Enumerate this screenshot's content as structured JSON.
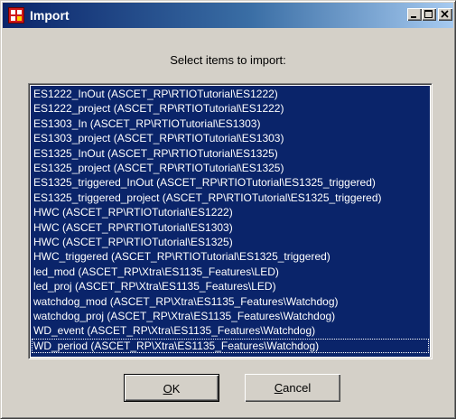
{
  "window": {
    "title": "Import",
    "title_icon": "import-app-icon",
    "controls": [
      "minimize-icon",
      "maximize-icon",
      "close-icon"
    ]
  },
  "prompt": "Select items to import:",
  "items": [
    "ES1222_InOut (ASCET_RP\\RTIOTutorial\\ES1222)",
    "ES1222_project (ASCET_RP\\RTIOTutorial\\ES1222)",
    "ES1303_In (ASCET_RP\\RTIOTutorial\\ES1303)",
    "ES1303_project (ASCET_RP\\RTIOTutorial\\ES1303)",
    "ES1325_InOut (ASCET_RP\\RTIOTutorial\\ES1325)",
    "ES1325_project (ASCET_RP\\RTIOTutorial\\ES1325)",
    "ES1325_triggered_InOut (ASCET_RP\\RTIOTutorial\\ES1325_triggered)",
    "ES1325_triggered_project (ASCET_RP\\RTIOTutorial\\ES1325_triggered)",
    "HWC (ASCET_RP\\RTIOTutorial\\ES1222)",
    "HWC (ASCET_RP\\RTIOTutorial\\ES1303)",
    "HWC (ASCET_RP\\RTIOTutorial\\ES1325)",
    "HWC_triggered (ASCET_RP\\RTIOTutorial\\ES1325_triggered)",
    "led_mod (ASCET_RP\\Xtra\\ES1135_Features\\LED)",
    "led_proj (ASCET_RP\\Xtra\\ES1135_Features\\LED)",
    "watchdog_mod (ASCET_RP\\Xtra\\ES1135_Features\\Watchdog)",
    "watchdog_proj (ASCET_RP\\Xtra\\ES1135_Features\\Watchdog)",
    "WD_event (ASCET_RP\\Xtra\\ES1135_Features\\Watchdog)",
    "WD_period (ASCET_RP\\Xtra\\ES1135_Features\\Watchdog)"
  ],
  "buttons": {
    "ok": {
      "mnemonic": "O",
      "rest": "K"
    },
    "cancel": {
      "mnemonic": "C",
      "rest": "ancel"
    }
  },
  "colors": {
    "titlebar_start": "#0a246a",
    "titlebar_end": "#a6caf0",
    "selection": "#0a246a",
    "dialog_face": "#d4d0c8"
  }
}
